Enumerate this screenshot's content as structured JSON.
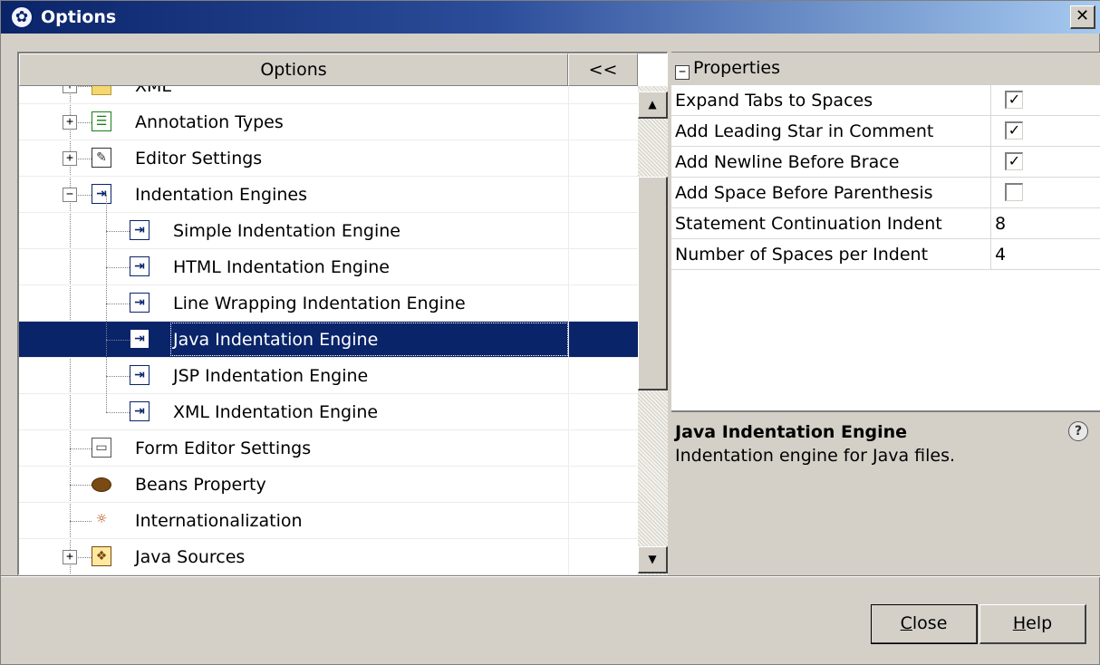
{
  "window": {
    "title": "Options",
    "close_glyph": "✕"
  },
  "tree": {
    "header_options": "Options",
    "header_collapse": "<<",
    "rows": [
      {
        "label": "XML",
        "depth": 1,
        "expander": "+",
        "icon": "folder-icon",
        "glyph": ""
      },
      {
        "label": "Annotation Types",
        "depth": 1,
        "expander": "+",
        "icon": "list-icon",
        "glyph": "☰"
      },
      {
        "label": "Editor Settings",
        "depth": 1,
        "expander": "+",
        "icon": "edit-icon",
        "glyph": "✎"
      },
      {
        "label": "Indentation Engines",
        "depth": 1,
        "expander": "−",
        "icon": "indent-icon",
        "glyph": "⇥"
      },
      {
        "label": "Simple Indentation Engine",
        "depth": 2,
        "icon": "indent-icon",
        "glyph": "⇥"
      },
      {
        "label": "HTML Indentation Engine",
        "depth": 2,
        "icon": "indent-icon",
        "glyph": "⇥"
      },
      {
        "label": "Line Wrapping Indentation Engine",
        "depth": 2,
        "icon": "indent-icon",
        "glyph": "⇥"
      },
      {
        "label": "Java Indentation Engine",
        "depth": 2,
        "icon": "indent-icon",
        "glyph": "⇥",
        "selected": true
      },
      {
        "label": "JSP Indentation Engine",
        "depth": 2,
        "icon": "indent-icon",
        "glyph": "⇥"
      },
      {
        "label": "XML Indentation Engine",
        "depth": 2,
        "icon": "indent-icon",
        "glyph": "⇥"
      },
      {
        "label": "Form Editor Settings",
        "depth": 1,
        "icon": "form-icon",
        "glyph": "▭"
      },
      {
        "label": "Beans Property",
        "depth": 1,
        "icon": "bean-icon",
        "glyph": ""
      },
      {
        "label": "Internationalization",
        "depth": 1,
        "icon": "internationalization-icon",
        "glyph": "☼"
      },
      {
        "label": "Java Sources",
        "depth": 1,
        "expander": "+",
        "icon": "java-icon",
        "glyph": "❖"
      }
    ]
  },
  "properties": {
    "header": "Properties",
    "header_glyph": "−",
    "rows": [
      {
        "name": "Expand Tabs to Spaces",
        "type": "checkbox",
        "checked": true
      },
      {
        "name": "Add Leading Star in Comment",
        "type": "checkbox",
        "checked": true
      },
      {
        "name": "Add Newline Before Brace",
        "type": "checkbox",
        "checked": true
      },
      {
        "name": "Add Space Before Parenthesis",
        "type": "checkbox",
        "checked": false
      },
      {
        "name": "Statement Continuation Indent",
        "type": "text",
        "value": "8"
      },
      {
        "name": "Number of Spaces per Indent",
        "type": "text",
        "value": "4"
      }
    ]
  },
  "description": {
    "title": "Java Indentation Engine",
    "text": "Indentation engine for Java files.",
    "help_glyph": "?"
  },
  "buttons": {
    "close_mnemonic": "C",
    "close_rest": "lose",
    "help_mnemonic": "H",
    "help_rest": "elp"
  },
  "scrollbar": {
    "up_glyph": "▲",
    "down_glyph": "▼"
  }
}
